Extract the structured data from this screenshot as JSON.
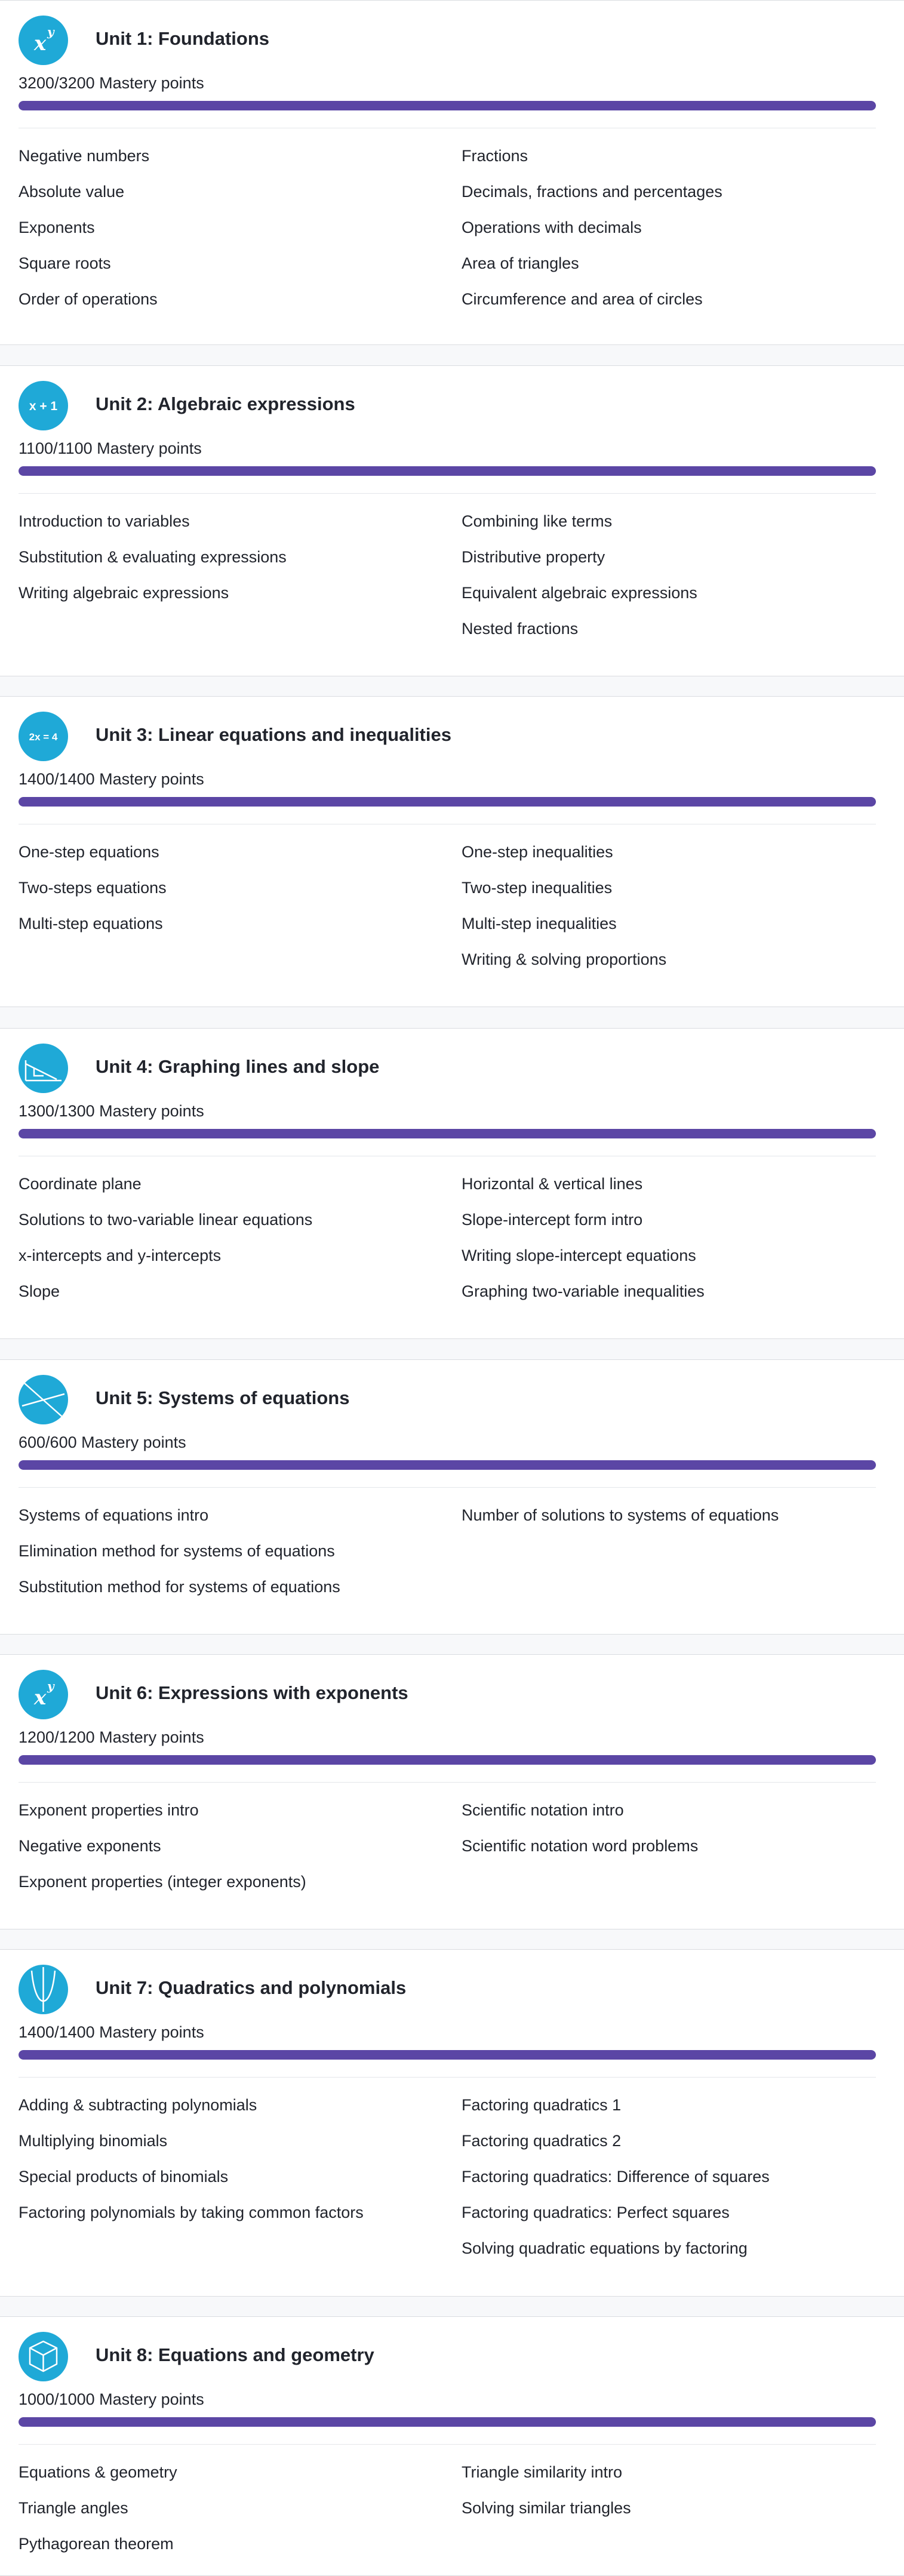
{
  "units": [
    {
      "title": "Unit 1: Foundations",
      "mastery": "3200/3200 Mastery points",
      "progress": 1.0,
      "icon": "superscript-xy-icon",
      "left_topics": [
        "Negative numbers",
        "Absolute value",
        "Exponents",
        "Square roots",
        "Order of operations"
      ],
      "right_topics": [
        "Fractions",
        "Decimals, fractions and percentages",
        "Operations with decimals",
        "Area of triangles",
        "Circumference and area of circles"
      ]
    },
    {
      "title": "Unit 2: Algebraic expressions",
      "mastery": "1100/1100 Mastery points",
      "progress": 1.0,
      "icon": "x-plus-one-icon",
      "icon_text": "x + 1",
      "left_topics": [
        "Introduction to variables",
        "Substitution & evaluating expressions",
        "Writing algebraic expressions"
      ],
      "right_topics": [
        "Combining like terms",
        "Distributive property",
        "Equivalent algebraic expressions",
        "Nested fractions"
      ]
    },
    {
      "title": "Unit 3: Linear equations and inequalities",
      "mastery": "1400/1400 Mastery points",
      "progress": 1.0,
      "icon": "equation-icon",
      "icon_text": "2x = 4",
      "left_topics": [
        "One-step equations",
        "Two-steps equations",
        "Multi-step equations"
      ],
      "right_topics": [
        "One-step inequalities",
        "Two-step inequalities",
        "Multi-step inequalities",
        "Writing & solving proportions"
      ]
    },
    {
      "title": "Unit 4: Graphing lines and slope",
      "mastery": "1300/1300 Mastery points",
      "progress": 1.0,
      "icon": "slope-graph-icon",
      "left_topics": [
        "Coordinate plane",
        "Solutions to two-variable linear equations",
        "x-intercepts and y-intercepts",
        "Slope"
      ],
      "right_topics": [
        "Horizontal & vertical lines",
        "Slope-intercept form intro",
        "Writing slope-intercept equations",
        "Graphing two-variable inequalities"
      ]
    },
    {
      "title": "Unit 5: Systems of equations",
      "mastery": "600/600 Mastery points",
      "progress": 1.0,
      "icon": "intersecting-lines-icon",
      "left_topics": [
        "Systems of equations intro",
        "Elimination method for systems of equations",
        "Substitution method for systems of equations"
      ],
      "right_topics": [
        "Number of solutions to systems of equations"
      ]
    },
    {
      "title": "Unit 6: Expressions with exponents",
      "mastery": "1200/1200 Mastery points",
      "progress": 1.0,
      "icon": "superscript-xy-icon",
      "left_topics": [
        "Exponent properties intro",
        "Negative exponents",
        "Exponent properties (integer exponents)"
      ],
      "right_topics": [
        "Scientific notation intro",
        "Scientific notation word problems"
      ]
    },
    {
      "title": "Unit 7: Quadratics and polynomials",
      "mastery": "1400/1400 Mastery points",
      "progress": 1.0,
      "icon": "parabola-icon",
      "left_topics": [
        "Adding & subtracting polynomials",
        "Multiplying binomials",
        "Special products of binomials",
        "Factoring polynomials by taking common factors"
      ],
      "right_topics": [
        "Factoring quadratics 1",
        "Factoring quadratics 2",
        "Factoring quadratics: Difference of squares",
        "Factoring quadratics: Perfect squares",
        "Solving quadratic equations by factoring"
      ]
    },
    {
      "title": "Unit 8: Equations and geometry",
      "mastery": "1000/1000 Mastery points",
      "progress": 1.0,
      "icon": "cube-icon",
      "left_topics": [
        "Equations & geometry",
        "Triangle angles",
        "Pythagorean theorem"
      ],
      "right_topics": [
        "Triangle similarity intro",
        "Solving similar triangles"
      ]
    }
  ],
  "colors": {
    "icon_bg": "#1fa9d7",
    "progress": "#5b46a5",
    "text": "#21242c"
  }
}
